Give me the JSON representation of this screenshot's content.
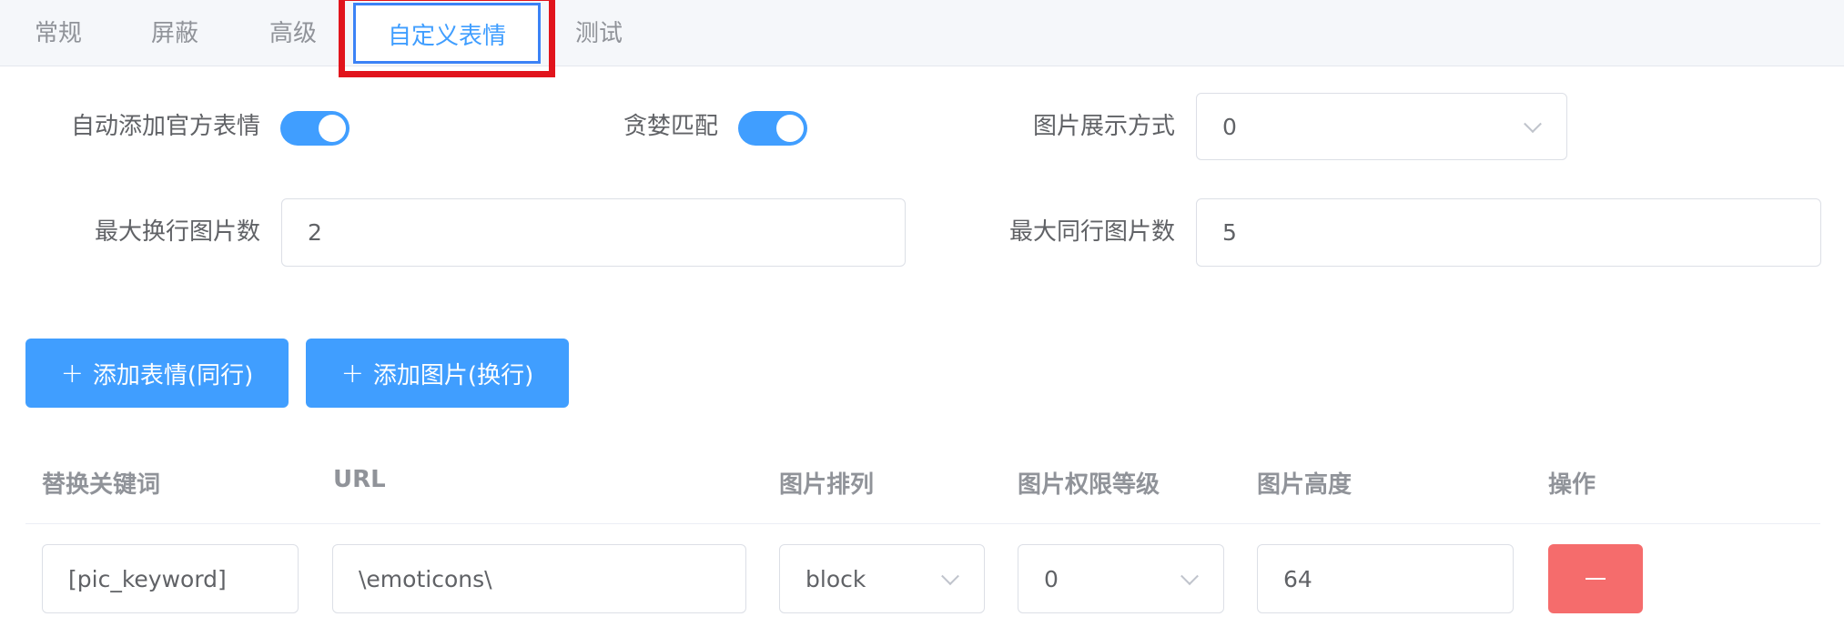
{
  "tabs": [
    {
      "label": "常规"
    },
    {
      "label": "屏蔽"
    },
    {
      "label": "高级"
    },
    {
      "label": "自定义表情",
      "active": true
    },
    {
      "label": "测试"
    }
  ],
  "form": {
    "auto_official_label": "自动添加官方表情",
    "auto_official_on": true,
    "greedy_label": "贪婪匹配",
    "greedy_on": true,
    "display_mode_label": "图片展示方式",
    "display_mode_value": "0",
    "max_break_label": "最大换行图片数",
    "max_break_value": "2",
    "max_inline_label": "最大同行图片数",
    "max_inline_value": "5"
  },
  "buttons": {
    "add_emoji_label": "添加表情(同行)",
    "add_image_label": "添加图片(换行)"
  },
  "table": {
    "headers": [
      "替换关键词",
      "URL",
      "图片排列",
      "图片权限等级",
      "图片高度",
      "操作"
    ],
    "rows": [
      {
        "keyword": "[pic_keyword]",
        "url": "\\emoticons\\",
        "arrange": "block",
        "level": "0",
        "height": "64"
      }
    ]
  },
  "colors": {
    "primary": "#409eff",
    "danger": "#f56c6c",
    "highlight": "#e1141c"
  }
}
